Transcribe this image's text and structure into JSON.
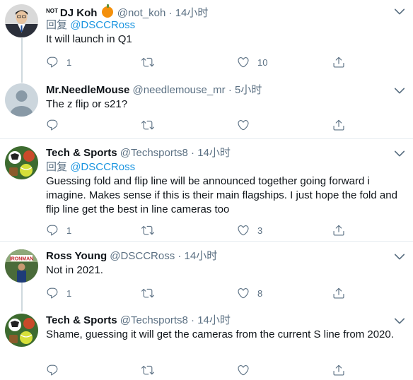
{
  "reply_prefix": "回复",
  "tweets": [
    {
      "name": "DJ Koh",
      "badge": "NOT",
      "has_pumpkin": true,
      "handle": "@not_koh",
      "sep": "·",
      "time": "14小时",
      "reply_to": "@DSCCRoss",
      "text": "It will launch in Q1",
      "replies": "1",
      "retweets": "",
      "likes": "10"
    },
    {
      "name": "Mr.NeedleMouse",
      "handle": "@needlemouse_mr",
      "sep": "·",
      "time": "5小时",
      "text": "The z flip or s21?",
      "replies": "",
      "retweets": "",
      "likes": ""
    },
    {
      "name": "Tech & Sports",
      "handle": "@Techsports8",
      "sep": "·",
      "time": "14小时",
      "reply_to": "@DSCCRoss",
      "text": "Guessing fold and flip line will be announced together going forward i imagine. Makes sense if this is their main flagships. I just hope the fold and flip line get the best in line cameras too",
      "replies": "1",
      "retweets": "",
      "likes": "3"
    },
    {
      "name": "Ross Young",
      "handle": "@DSCCRoss",
      "sep": "·",
      "time": "14小时",
      "text": "Not in 2021.",
      "replies": "1",
      "retweets": "",
      "likes": "8"
    },
    {
      "name": "Tech & Sports",
      "handle": "@Techsports8",
      "sep": "·",
      "time": "14小时",
      "text": "Shame, guessing it will get the cameras from the current S line from 2020.",
      "replies": "",
      "retweets": "",
      "likes": ""
    }
  ]
}
